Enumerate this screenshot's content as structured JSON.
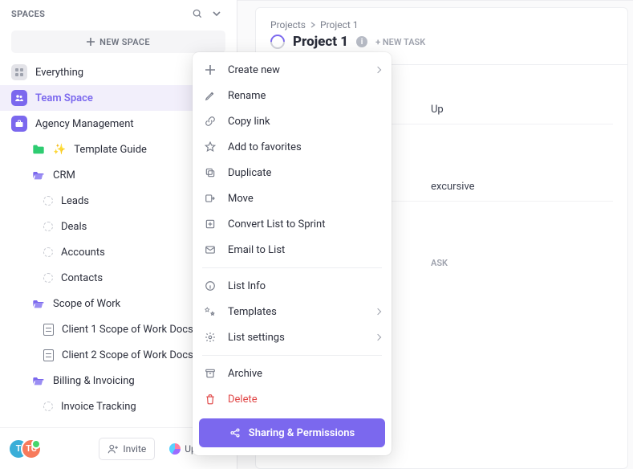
{
  "sidebar": {
    "title": "SPACES",
    "new_space_label": "NEW SPACE",
    "spaces": [
      {
        "name": "Everything",
        "kind": "everything"
      },
      {
        "name": "Team Space",
        "kind": "space",
        "active": true
      },
      {
        "name": "Agency Management",
        "kind": "space"
      }
    ],
    "tree": [
      {
        "type": "folder",
        "color": "#2ecc71",
        "prefix": "✨",
        "label": "Template Guide"
      },
      {
        "type": "folder",
        "color": "#7b68ee",
        "label": "CRM",
        "open": true,
        "ellipsis": true
      },
      {
        "type": "list",
        "label": "Leads"
      },
      {
        "type": "list",
        "label": "Deals"
      },
      {
        "type": "list",
        "label": "Accounts"
      },
      {
        "type": "list",
        "label": "Contacts"
      },
      {
        "type": "folder",
        "color": "#7b68ee",
        "label": "Scope of Work",
        "ellipsis": true
      },
      {
        "type": "doc",
        "label": "Client 1 Scope of Work Docs"
      },
      {
        "type": "doc",
        "label": "Client 2 Scope of Work Docs"
      },
      {
        "type": "folder",
        "color": "#7b68ee",
        "label": "Billing & Invoicing",
        "ellipsis": true
      },
      {
        "type": "list",
        "label": "Invoice Tracking"
      }
    ],
    "footer": {
      "avatars": [
        {
          "initial": "T",
          "color": "#3aaed8"
        },
        {
          "initial": "TC",
          "color": "#f77a5b"
        }
      ],
      "invite_label": "Invite",
      "upgrade_label": "Upgrade"
    }
  },
  "main": {
    "breadcrumb": [
      "Projects",
      "Project 1"
    ],
    "title": "Project 1",
    "new_task_label": "+ NEW TASK",
    "rows": [
      {
        "text": "Up"
      },
      {
        "text": "excursive"
      },
      {
        "text": "ASK",
        "faint": true
      }
    ]
  },
  "context_menu": {
    "groups": [
      [
        {
          "icon": "plus",
          "label": "Create new",
          "chevron": true
        },
        {
          "icon": "pencil",
          "label": "Rename"
        },
        {
          "icon": "link",
          "label": "Copy link"
        },
        {
          "icon": "star",
          "label": "Add to favorites"
        },
        {
          "icon": "duplicate",
          "label": "Duplicate"
        },
        {
          "icon": "move",
          "label": "Move"
        },
        {
          "icon": "convert",
          "label": "Convert List to Sprint"
        },
        {
          "icon": "mail",
          "label": "Email to List"
        }
      ],
      [
        {
          "icon": "info",
          "label": "List Info"
        },
        {
          "icon": "templates",
          "label": "Templates",
          "chevron": true
        },
        {
          "icon": "settings",
          "label": "List settings",
          "chevron": true
        }
      ],
      [
        {
          "icon": "archive",
          "label": "Archive"
        },
        {
          "icon": "trash",
          "label": "Delete",
          "danger": true
        }
      ]
    ],
    "cta_label": "Sharing & Permissions"
  },
  "colors": {
    "accent": "#7b68ee",
    "danger": "#e04444"
  }
}
